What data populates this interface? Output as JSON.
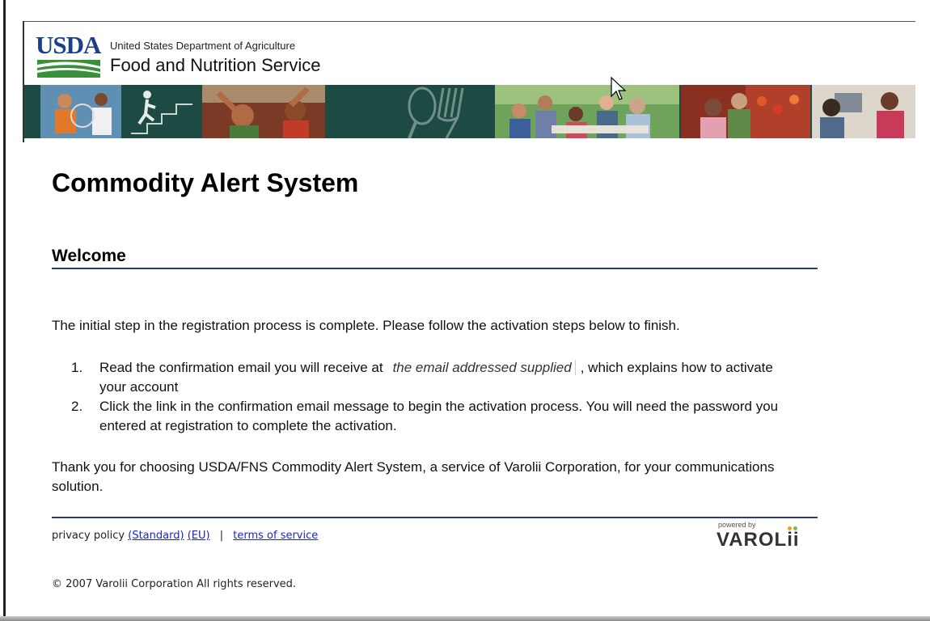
{
  "header": {
    "logo_text": "USDA",
    "agency_small": "United States Department of Agriculture",
    "agency_large": "Food and Nutrition Service"
  },
  "page": {
    "title": "Commodity Alert System",
    "section_title": "Welcome",
    "intro": "The initial step in the registration process is complete. Please follow the activation steps below to finish.",
    "steps": [
      {
        "number": "1.",
        "before": "Read the confirmation email you will receive at",
        "email_placeholder": "the email addressed supplied",
        "after": ", which explains how to activate your account"
      },
      {
        "number": "2.",
        "text": "Click the link in the confirmation email message to begin the activation process. You will need the password you entered at registration to complete the activation."
      }
    ],
    "thanks": "Thank you for choosing USDA/FNS Commodity Alert System, a service of Varolii Corporation, for your communications solution."
  },
  "footer": {
    "privacy_label": "privacy policy",
    "standard_link": "(Standard)",
    "eu_link": "(EU)",
    "separator": "|",
    "terms_link": "terms of service",
    "copyright": "© 2007 Varolii Corporation All rights reserved.",
    "powered_by": "powered by",
    "brand": "VAROL",
    "brand_suffix": "ii"
  },
  "colors": {
    "banner": "#1d4a42",
    "rule": "#283a8a",
    "link": "#1a26c9",
    "usda_blue": "#1b3f8a",
    "usda_green": "#3a8f3a"
  }
}
